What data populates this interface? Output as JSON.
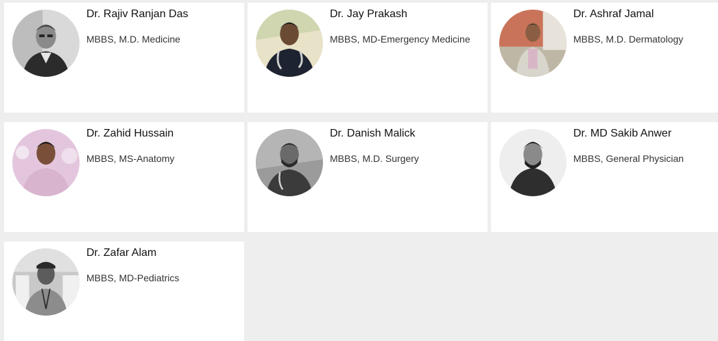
{
  "doctors": [
    {
      "name": "Dr. Rajiv Ranjan Das",
      "degree": "MBBS, M.D. Medicine"
    },
    {
      "name": "Dr. Jay Prakash",
      "degree": "MBBS, MD-Emergency Medicine"
    },
    {
      "name": "Dr. Ashraf Jamal",
      "degree": "MBBS, M.D. Dermatology"
    },
    {
      "name": "Dr. Zahid Hussain",
      "degree": "MBBS, MS-Anatomy"
    },
    {
      "name": "Dr. Danish Malick",
      "degree": "MBBS, M.D. Surgery"
    },
    {
      "name": "Dr. MD Sakib Anwer",
      "degree": "MBBS, General Physician"
    },
    {
      "name": "Dr. Zafar Alam",
      "degree": "MBBS, MD-Pediatrics"
    }
  ],
  "colors": {
    "page_background": "#eeeeee",
    "card_background": "#ffffff",
    "name_text": "#111111",
    "degree_text": "#333333"
  }
}
